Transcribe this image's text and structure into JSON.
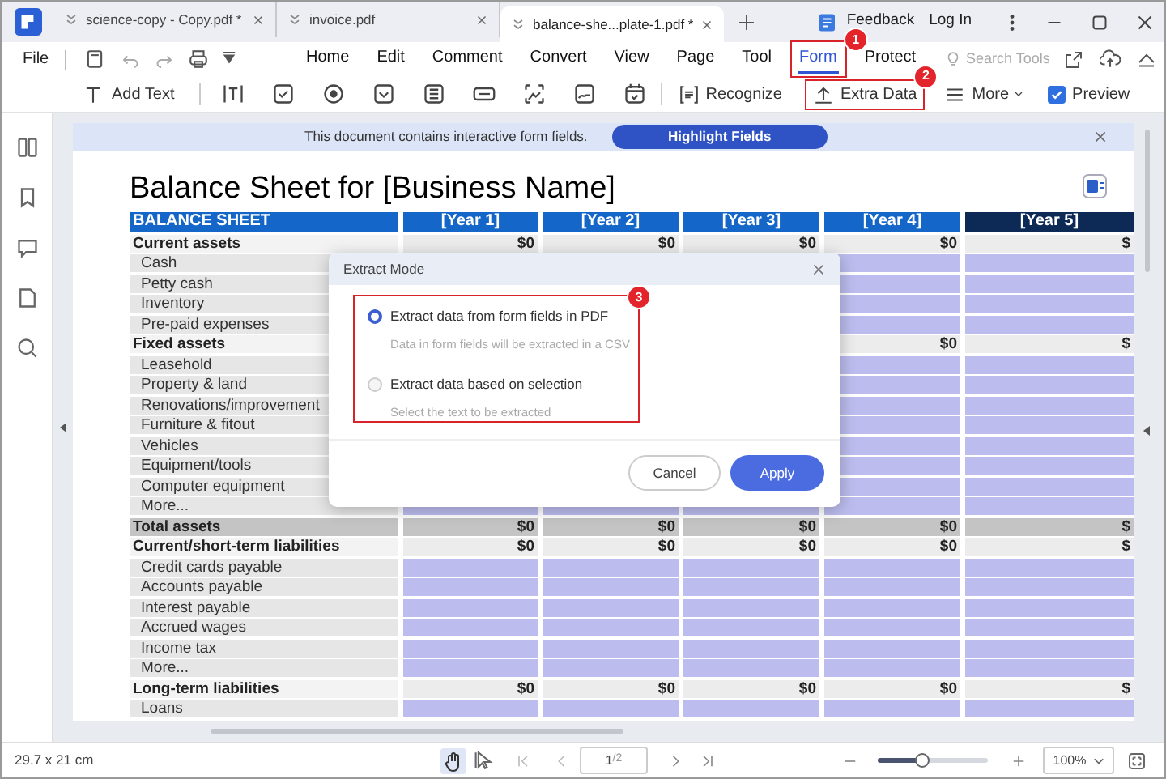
{
  "tabs": [
    {
      "label": "science-copy - Copy.pdf *",
      "selected": false
    },
    {
      "label": "invoice.pdf",
      "selected": false
    },
    {
      "label": "balance-she...plate-1.pdf *",
      "selected": true
    }
  ],
  "header_links": [
    "Feedback",
    "Log In"
  ],
  "menu": {
    "file": "File",
    "items": [
      {
        "label": "Home",
        "selected": false
      },
      {
        "label": "Edit",
        "selected": false
      },
      {
        "label": "Comment",
        "selected": false
      },
      {
        "label": "Convert",
        "selected": false
      },
      {
        "label": "View",
        "selected": false
      },
      {
        "label": "Page",
        "selected": false
      },
      {
        "label": "Tool",
        "selected": false
      },
      {
        "label": "Form",
        "selected": true,
        "callout": "1"
      },
      {
        "label": "Protect",
        "selected": false
      }
    ],
    "search_placeholder": "Search Tools"
  },
  "toolbar": {
    "add_text": "Add Text",
    "recognize": "Recognize",
    "extra_data": {
      "label": "Extra Data",
      "callout": "2"
    },
    "more": "More",
    "preview": {
      "label": "Preview",
      "checked": true
    }
  },
  "notice": {
    "text": "This document contains interactive form fields.",
    "button": "Highlight Fields"
  },
  "sheet": {
    "title": "Balance Sheet for [Business Name]",
    "columns": [
      {
        "label": "BALANCE SHEET",
        "color": "#1467c8"
      },
      {
        "label": "[Year 1]",
        "color": "#1467c8"
      },
      {
        "label": "[Year 2]",
        "color": "#1467c8"
      },
      {
        "label": "[Year 3]",
        "color": "#1467c8"
      },
      {
        "label": "[Year 4]",
        "color": "#1467c8"
      },
      {
        "label": "[Year 5]",
        "color": "#0c2a55"
      }
    ],
    "rows": [
      {
        "kind": "section",
        "label": "Current assets",
        "values": [
          "$0",
          "$0",
          "$0",
          "$0",
          "$"
        ]
      },
      {
        "kind": "item",
        "label": "Cash"
      },
      {
        "kind": "item",
        "label": "Petty cash"
      },
      {
        "kind": "item",
        "label": "Inventory"
      },
      {
        "kind": "item",
        "label": "Pre-paid expenses"
      },
      {
        "kind": "section",
        "label": "Fixed assets",
        "values": [
          "$0",
          "$"
        ]
      },
      {
        "kind": "item",
        "label": "Leasehold"
      },
      {
        "kind": "item",
        "label": "Property & land"
      },
      {
        "kind": "item",
        "label": "Renovations/improvement"
      },
      {
        "kind": "item",
        "label": "Furniture & fitout"
      },
      {
        "kind": "item",
        "label": "Vehicles"
      },
      {
        "kind": "item",
        "label": "Equipment/tools"
      },
      {
        "kind": "item",
        "label": "Computer equipment"
      },
      {
        "kind": "item",
        "label": "More..."
      },
      {
        "kind": "total",
        "label": "Total assets",
        "values": [
          "$0",
          "$0",
          "$0",
          "$0",
          "$"
        ]
      },
      {
        "kind": "section",
        "label": "Current/short-term liabilities",
        "values": [
          "$0",
          "$0",
          "$0",
          "$0",
          "$"
        ]
      },
      {
        "kind": "item",
        "label": "Credit cards payable"
      },
      {
        "kind": "item",
        "label": "Accounts payable"
      },
      {
        "kind": "item",
        "label": "Interest payable"
      },
      {
        "kind": "item",
        "label": "Accrued wages"
      },
      {
        "kind": "item",
        "label": "Income tax"
      },
      {
        "kind": "item",
        "label": "More..."
      },
      {
        "kind": "section",
        "label": "Long-term liabilities",
        "values": [
          "$0",
          "$0",
          "$0",
          "$0",
          "$"
        ]
      },
      {
        "kind": "item",
        "label": "Loans"
      }
    ]
  },
  "dialog": {
    "title": "Extract Mode",
    "callout": "3",
    "options": [
      {
        "label": "Extract data from form fields in PDF",
        "hint": "Data in form fields will be extracted in a CSV",
        "selected": true
      },
      {
        "label": "Extract data based on selection",
        "hint": "Select the text to be extracted",
        "selected": false
      }
    ],
    "cancel": "Cancel",
    "apply": "Apply"
  },
  "status_bar": {
    "page_size": "29.7 x 21 cm",
    "hand_tool": {
      "selected": true
    },
    "page": "1",
    "page_count": "/2",
    "zoom_slider": {
      "level": 0.39
    },
    "zoom": "100%"
  }
}
